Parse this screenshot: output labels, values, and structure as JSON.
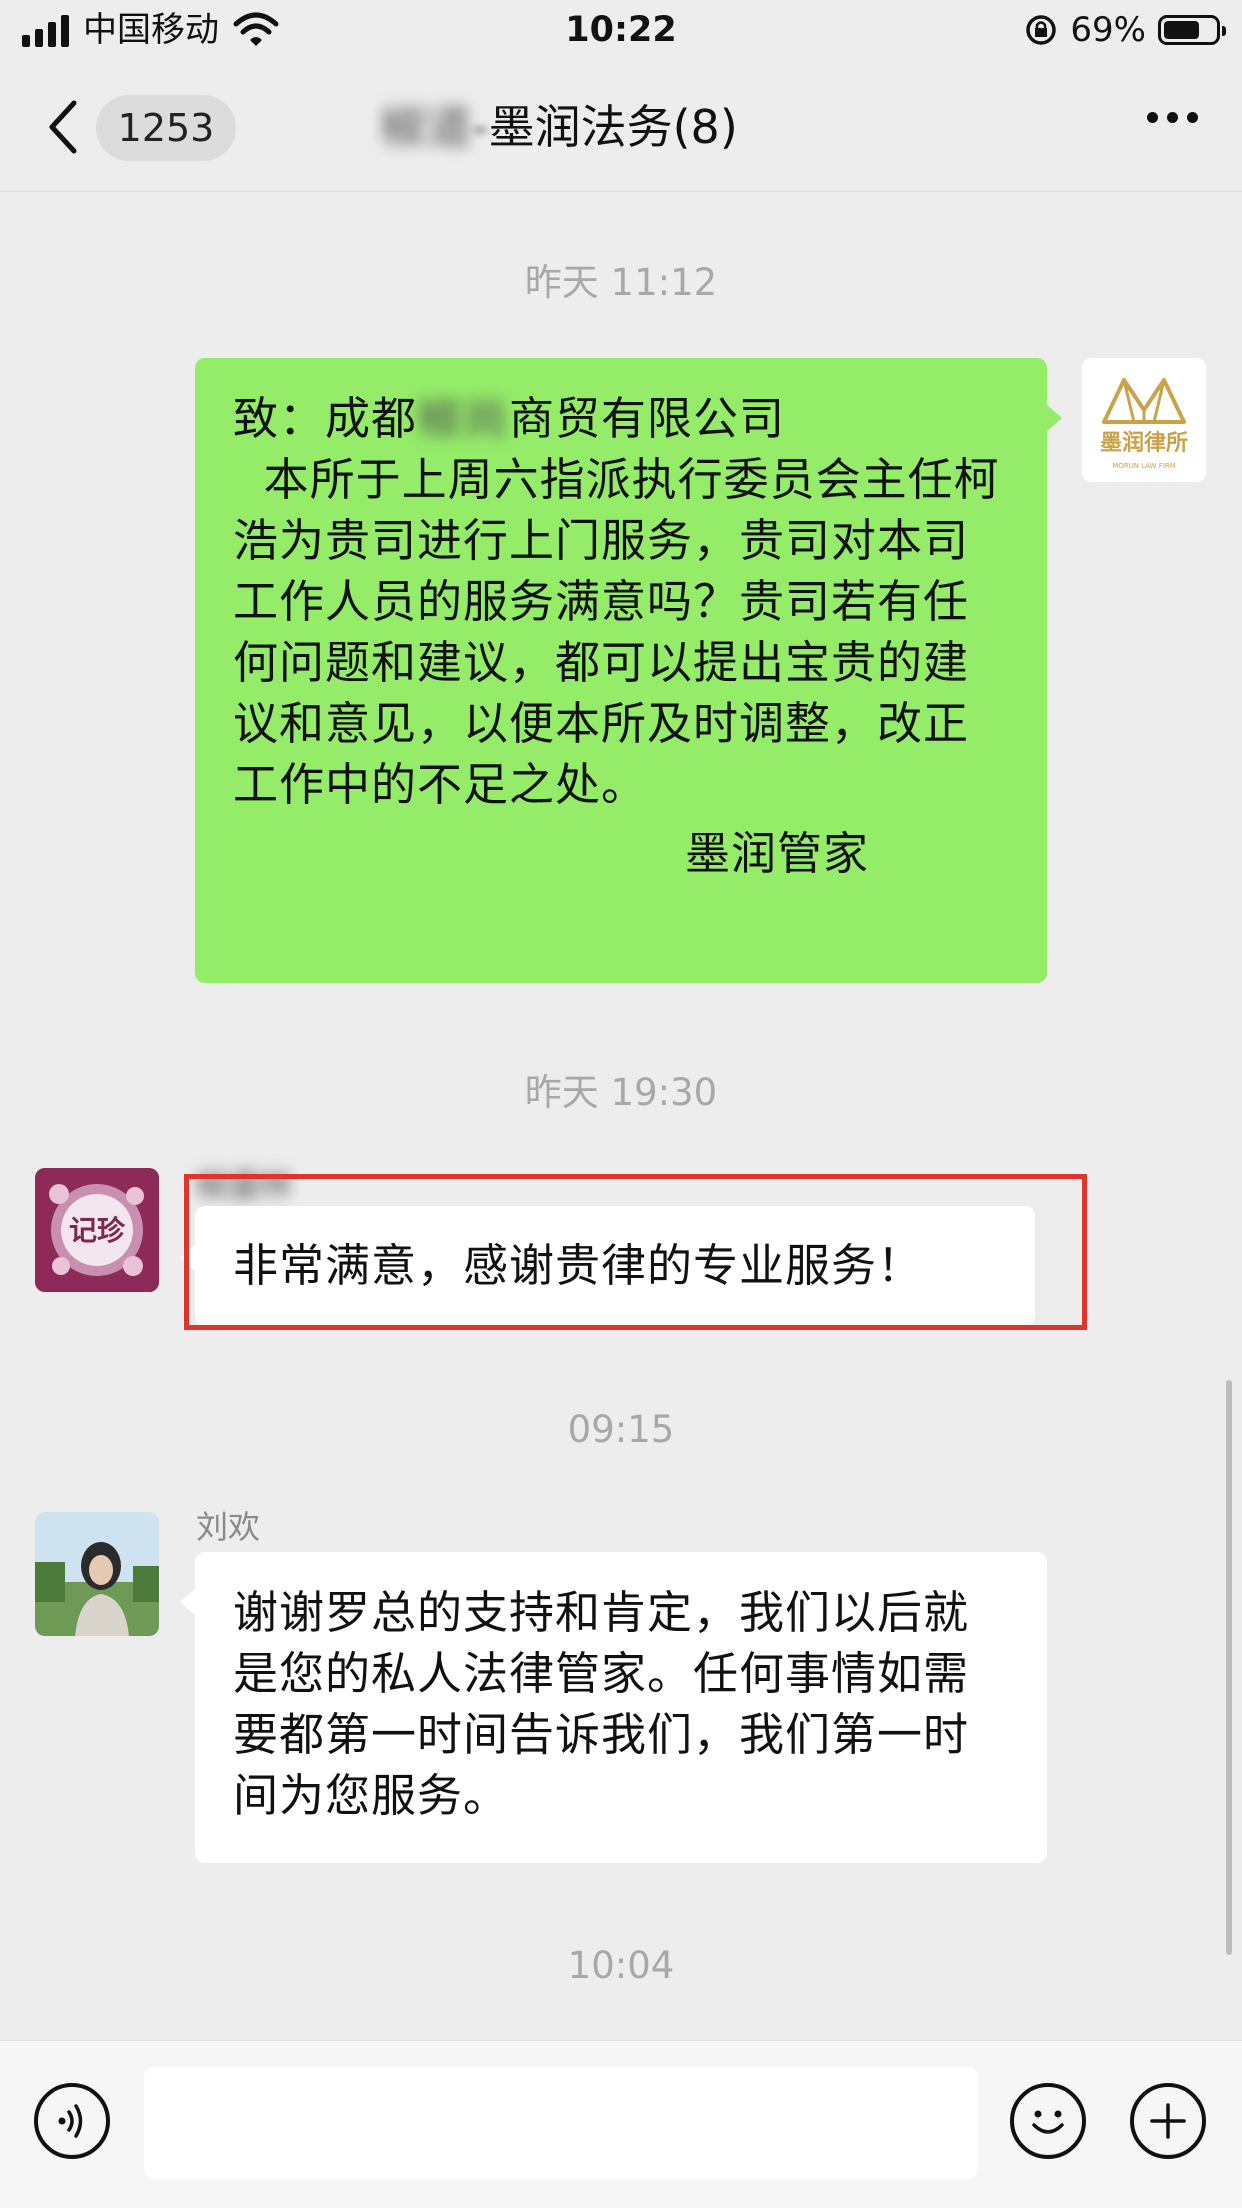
{
  "status_bar": {
    "carrier": "中国移动",
    "time": "10:22",
    "battery_percent_text": "69%",
    "battery_level": 0.69
  },
  "nav": {
    "unread_count": "1253",
    "title_blurred": "椒道",
    "title_mid": "-",
    "title_visible": "墨润法务(8)",
    "back_icon": "chevron-left-icon",
    "more_icon": "more-dots-icon"
  },
  "messages": {
    "ts1": "昨天 11:12",
    "msg1": {
      "prefix": "致：成都",
      "blurred_part": "椒尚",
      "suffix": "商贸有限公司",
      "body": "  本所于上周六指派执行委员会主任柯浩为贵司进行上门服务，贵司对本司工作人员的服务满意吗？贵司若有任何问题和建议，都可以提出宝贵的建议和意见，以便本所及时调整，改正工作中的不足之处。",
      "signoff": "墨润管家",
      "avatar_text": "墨润律所",
      "avatar_subtext": "MORUN LAW FIRM",
      "bubble_color": "#95ec69"
    },
    "ts2": "昨天 19:30",
    "msg2": {
      "sender_blurred": "椒盛林",
      "text": "非常满意，感谢贵律的专业服务！",
      "avatar_text": "记珍"
    },
    "ts3": "09:15",
    "msg3": {
      "sender": "刘欢",
      "text": "谢谢罗总的支持和肯定，我们以后就是您的私人法律管家。任何事情如需要都第一时间告诉我们，我们第一时间为您服务。"
    },
    "ts4": "10:04"
  },
  "highlight_color": "#e0332a",
  "input_bar": {
    "voice_icon": "voice-icon",
    "emoji_icon": "emoji-icon",
    "add_icon": "plus-circle-icon",
    "value": ""
  }
}
